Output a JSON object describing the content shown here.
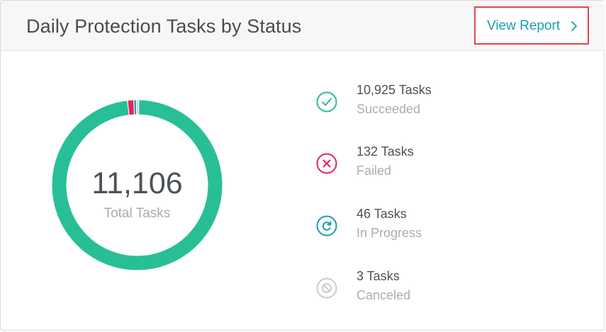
{
  "header": {
    "title": "Daily Protection Tasks by Status",
    "view_report_label": "View Report"
  },
  "summary": {
    "total_value": "11,106",
    "total_label": "Total Tasks"
  },
  "statuses": [
    {
      "count": "10,925 Tasks",
      "label": "Succeeded",
      "value": 10925,
      "color": "#28bf97",
      "icon": "check-circle-icon"
    },
    {
      "count": "132 Tasks",
      "label": "Failed",
      "value": 132,
      "color": "#e3245f",
      "icon": "x-circle-icon"
    },
    {
      "count": "46 Tasks",
      "label": "In Progress",
      "value": 46,
      "color": "#1a9cb0",
      "icon": "refresh-circle-icon"
    },
    {
      "count": "3 Tasks",
      "label": "Canceled",
      "value": 3,
      "color": "#c7cccf",
      "icon": "cancel-circle-icon"
    }
  ],
  "colors": {
    "accent": "#1a9cb0",
    "highlight_border": "#e0474c"
  }
}
